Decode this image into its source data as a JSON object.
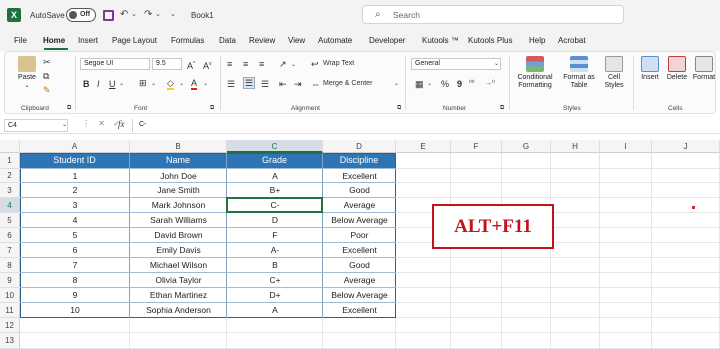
{
  "titlebar": {
    "autosave_label": "AutoSave",
    "autosave_state": "Off",
    "doc_title": "Book1",
    "search_placeholder": "Search"
  },
  "menu_tabs": [
    "File",
    "Home",
    "Insert",
    "Page Layout",
    "Formulas",
    "Data",
    "Review",
    "View",
    "Automate",
    "Developer",
    "Kutools ™",
    "Kutools Plus",
    "Help",
    "Acrobat"
  ],
  "active_tab": "Home",
  "ribbon": {
    "clipboard": {
      "paste": "Paste",
      "group": "Clipboard"
    },
    "font": {
      "family": "Segoe UI",
      "size": "9.5",
      "group": "Font"
    },
    "alignment": {
      "wrap_text": "Wrap Text",
      "merge_center": "Merge & Center",
      "group": "Alignment"
    },
    "number": {
      "format": "General",
      "group": "Number"
    },
    "styles": {
      "conditional": "Conditional Formatting",
      "format_table": "Format as Table",
      "cell_styles": "Cell Styles",
      "group": "Styles"
    },
    "cells": {
      "insert": "Insert",
      "delete": "Delete",
      "format": "Format",
      "group": "Cells"
    }
  },
  "formula_bar": {
    "name_box": "C4",
    "content": "C-"
  },
  "columns": [
    "A",
    "B",
    "C",
    "D",
    "E",
    "F",
    "G",
    "H",
    "I",
    "J"
  ],
  "rows": [
    "1",
    "2",
    "3",
    "4",
    "5",
    "6",
    "7",
    "8",
    "9",
    "10",
    "11",
    "12",
    "13"
  ],
  "table": {
    "headers": [
      "Student ID",
      "Name",
      "Grade",
      "Discipline"
    ],
    "rows": [
      [
        "1",
        "John Doe",
        "A",
        "Excellent"
      ],
      [
        "2",
        "Jane Smith",
        "B+",
        "Good"
      ],
      [
        "3",
        "Mark Johnson",
        "C-",
        "Average"
      ],
      [
        "4",
        "Sarah Williams",
        "D",
        "Below Average"
      ],
      [
        "5",
        "David Brown",
        "F",
        "Poor"
      ],
      [
        "6",
        "Emily Davis",
        "A-",
        "Excellent"
      ],
      [
        "7",
        "Michael Wilson",
        "B",
        "Good"
      ],
      [
        "8",
        "Olivia Taylor",
        "C+",
        "Average"
      ],
      [
        "9",
        "Ethan Martinez",
        "D+",
        "Below Average"
      ],
      [
        "10",
        "Sophia Anderson",
        "A",
        "Excellent"
      ]
    ]
  },
  "callout_text": "ALT+F11",
  "colors": {
    "header_fill": "#2e75b6",
    "accent": "#217346",
    "callout": "#c0141a"
  }
}
